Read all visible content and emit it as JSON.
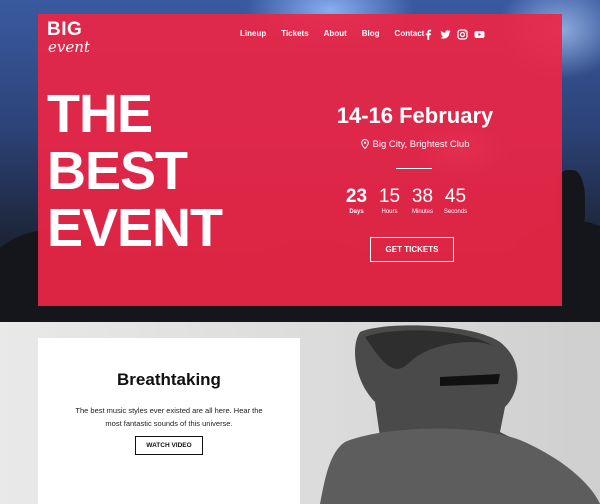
{
  "brand": {
    "logo_top": "BIG",
    "logo_bottom": "event"
  },
  "nav": {
    "items": [
      {
        "label": "Lineup"
      },
      {
        "label": "Tickets"
      },
      {
        "label": "About"
      },
      {
        "label": "Blog"
      },
      {
        "label": "Contact"
      }
    ]
  },
  "social": {
    "icons": [
      "facebook-icon",
      "twitter-icon",
      "instagram-icon",
      "youtube-icon"
    ]
  },
  "hero": {
    "headline": [
      "THE",
      "BEST",
      "EVENT"
    ],
    "date": "14-16 February",
    "venue": "Big City, Brightest Club",
    "countdown": [
      {
        "value": "23",
        "label": "Days"
      },
      {
        "value": "15",
        "label": "Hours"
      },
      {
        "value": "38",
        "label": "Minutes"
      },
      {
        "value": "45",
        "label": "Seconds"
      }
    ],
    "cta_label": "GET TICKETS",
    "accent_color": "#ec2646"
  },
  "feature": {
    "title": "Breathtaking",
    "text": "The best music styles ever existed are all here. Hear the most fantastic sounds of this universe.",
    "cta_label": "WATCH VIDEO"
  }
}
